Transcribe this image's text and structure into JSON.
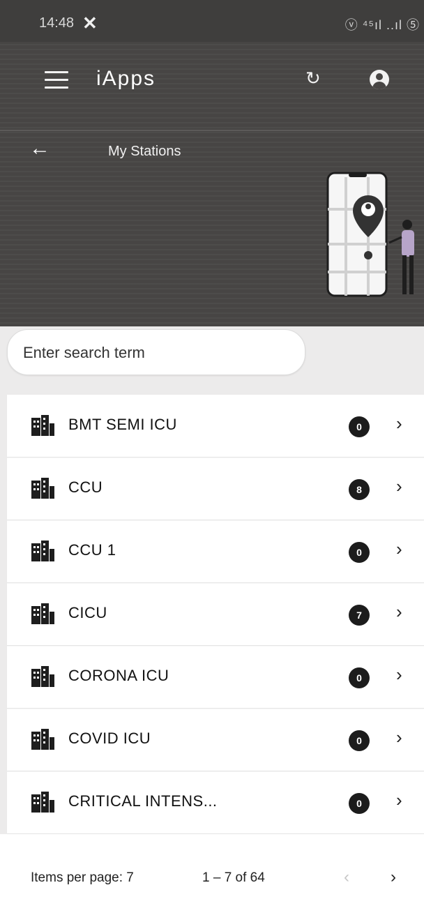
{
  "status_bar": {
    "time": "14:48",
    "notification_icon": "x-icon",
    "right_icons": "ⓥ ⁴⁵ıl ..ıl ⑤"
  },
  "app_bar": {
    "title": "iApps",
    "menu_icon": "menu-icon",
    "refresh_icon": "refresh-icon",
    "account_icon": "account-icon"
  },
  "sub_header": {
    "title": "My Stations",
    "back_icon": "arrow-left-icon"
  },
  "search": {
    "placeholder": "Enter search term",
    "value": ""
  },
  "stations": [
    {
      "name": "BMT SEMI ICU",
      "count": "0"
    },
    {
      "name": "CCU",
      "count": "8"
    },
    {
      "name": "CCU 1",
      "count": "0"
    },
    {
      "name": "CICU",
      "count": "7"
    },
    {
      "name": "CORONA ICU",
      "count": "0"
    },
    {
      "name": "COVID ICU",
      "count": "0"
    },
    {
      "name": "CRITICAL INTENS...",
      "count": "0"
    }
  ],
  "pagination": {
    "items_per_page": "Items per page: 7",
    "range": "1 – 7 of 64",
    "prev_icon": "chevron-left-icon",
    "next_icon": "chevron-right-icon"
  },
  "colors": {
    "header_bg": "#474544",
    "page_bg": "#ecebeb",
    "badge_bg": "#1c1c1c",
    "text": "#111111"
  }
}
